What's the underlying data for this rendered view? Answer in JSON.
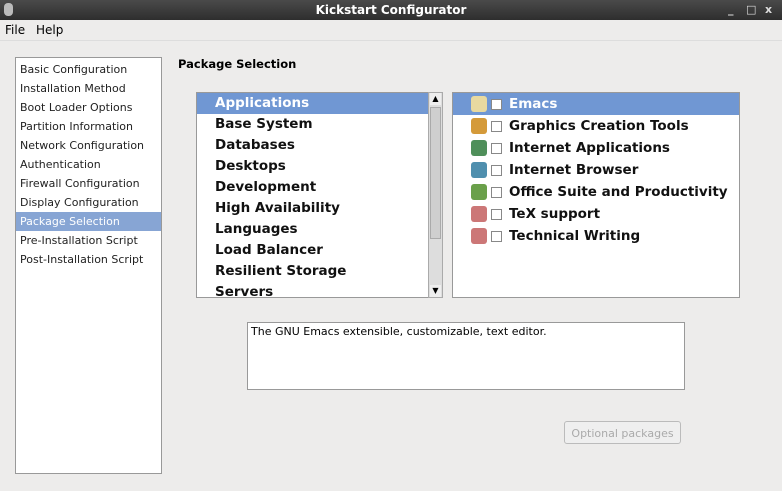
{
  "window": {
    "title": "Kickstart Configurator",
    "minimize": "_",
    "maximize": "□",
    "close": "x"
  },
  "menu": {
    "file": "File",
    "help": "Help"
  },
  "sidebar": {
    "items": [
      "Basic Configuration",
      "Installation Method",
      "Boot Loader Options",
      "Partition Information",
      "Network Configuration",
      "Authentication",
      "Firewall Configuration",
      "Display Configuration",
      "Package Selection",
      "Pre-Installation Script",
      "Post-Installation Script"
    ],
    "selected": 8
  },
  "main": {
    "heading": "Package Selection",
    "groups": [
      "Applications",
      "Base System",
      "Databases",
      "Desktops",
      "Development",
      "High Availability",
      "Languages",
      "Load Balancer",
      "Resilient Storage",
      "Servers"
    ],
    "packages": [
      {
        "label": "Emacs",
        "icon": "editor-icon",
        "color": "#e8d9a0"
      },
      {
        "label": "Graphics Creation Tools",
        "icon": "paint-icon",
        "color": "#d49a3a"
      },
      {
        "label": "Internet Applications",
        "icon": "globe-icon",
        "color": "#4f8f5a"
      },
      {
        "label": "Internet Browser",
        "icon": "globe-icon",
        "color": "#4f8fae"
      },
      {
        "label": "Office Suite and Productivity",
        "icon": "office-icon",
        "color": "#6aa04a"
      },
      {
        "label": "TeX support",
        "icon": "book-icon",
        "color": "#c77"
      },
      {
        "label": "Technical Writing",
        "icon": "book-icon",
        "color": "#c77"
      }
    ],
    "description": "The GNU Emacs extensible, customizable, text editor.",
    "optional_button": "Optional packages"
  }
}
